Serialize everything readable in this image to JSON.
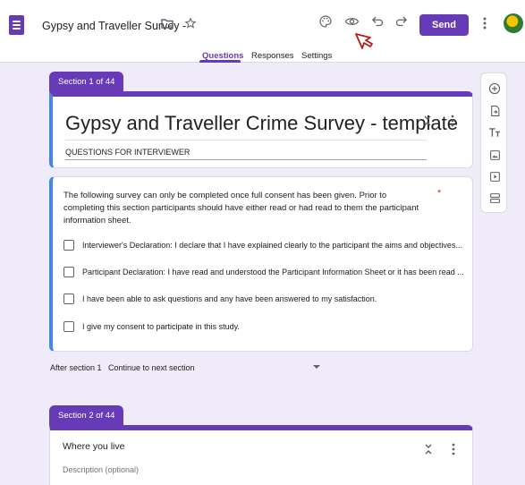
{
  "header": {
    "doc_title": "Gypsy and Traveller Survey -",
    "send_label": "Send",
    "tabs": [
      {
        "label": "Questions",
        "active": true
      },
      {
        "label": "Responses",
        "active": false
      },
      {
        "label": "Settings",
        "active": false
      }
    ],
    "icons": [
      "palette-icon",
      "preview-eye-icon",
      "undo-icon",
      "redo-icon",
      "more-vert-icon"
    ]
  },
  "section1": {
    "tag": "Section 1 of 44",
    "title": "Gypsy and Traveller Crime Survey - template",
    "description": "QUESTIONS FOR INTERVIEWER"
  },
  "question": {
    "text": "The following survey can only be completed once full consent has been given. Prior to completing this section participants should have either read or had read to them the participant information sheet.",
    "required_mark": "*",
    "options": [
      "Interviewer's Declaration: I declare that I have explained clearly to the participant the aims and objectives...",
      "Participant Declaration: I have read and understood the Participant Information Sheet or it has been read ...",
      "I have been able to ask questions and any have been answered to my satisfaction.",
      "I give my consent to participate in this study."
    ]
  },
  "after_section": {
    "label": "After section 1",
    "value": "Continue to next section"
  },
  "section2": {
    "tag": "Section 2 of 44",
    "title": "Where you live",
    "description_placeholder": "Description (optional)"
  },
  "toolbar": [
    "add-question-icon",
    "import-questions-icon",
    "add-title-icon",
    "add-image-icon",
    "add-video-icon",
    "add-section-icon"
  ],
  "colors": {
    "accent": "#673ab7",
    "focus": "#4285f4",
    "background": "#f0ebf8"
  }
}
